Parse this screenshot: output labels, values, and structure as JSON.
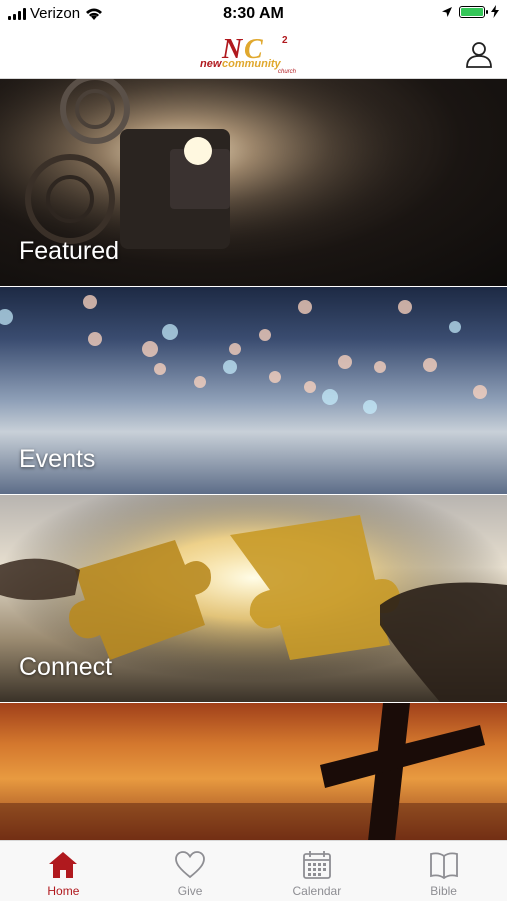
{
  "status_bar": {
    "carrier": "Verizon",
    "time": "8:30 AM"
  },
  "header": {
    "logo_text": "NC",
    "logo_sup": "2",
    "logo_sub": "newcommunity",
    "logo_small": "church"
  },
  "tiles": [
    {
      "label": "Featured"
    },
    {
      "label": "Events"
    },
    {
      "label": "Connect"
    },
    {
      "label": ""
    }
  ],
  "tab_bar": {
    "items": [
      {
        "label": "Home",
        "icon": "home-icon",
        "active": true
      },
      {
        "label": "Give",
        "icon": "heart-icon",
        "active": false
      },
      {
        "label": "Calendar",
        "icon": "calendar-icon",
        "active": false
      },
      {
        "label": "Bible",
        "icon": "book-icon",
        "active": false
      }
    ]
  },
  "colors": {
    "accent": "#b0191e",
    "inactive": "#8e8e93",
    "battery": "#35c759"
  }
}
